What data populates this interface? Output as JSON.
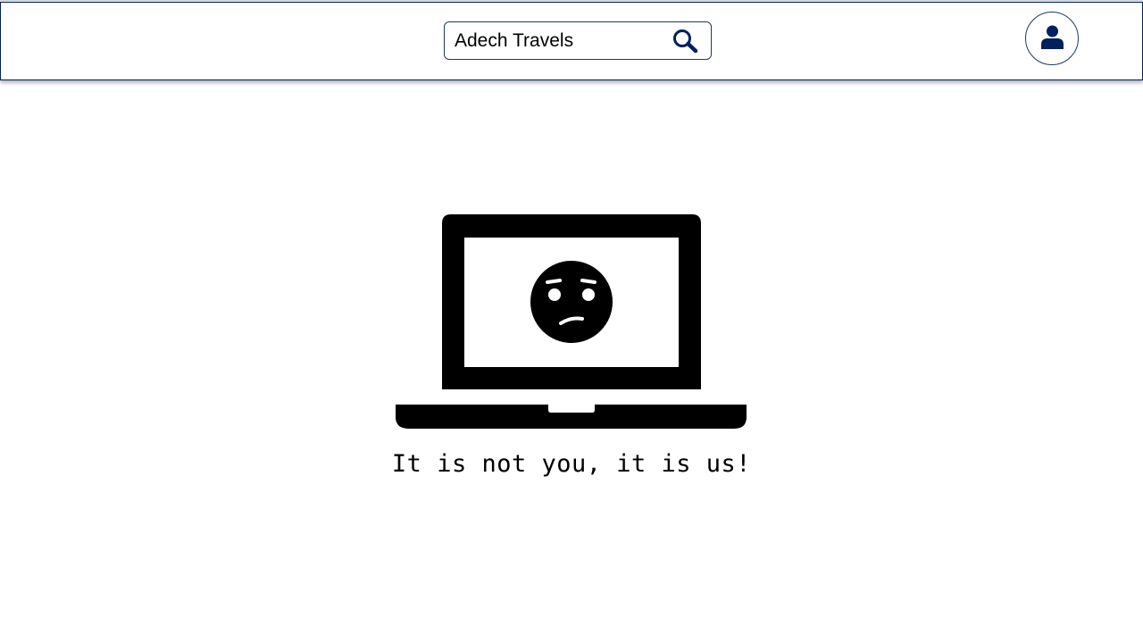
{
  "header": {
    "search": {
      "value": "Adech Travels",
      "icon": "search-icon"
    },
    "account": {
      "icon": "user-icon"
    }
  },
  "error": {
    "illustration_icon": "laptop-sad-face-icon",
    "message": "It is not you, it is us!"
  },
  "colors": {
    "accent": "#002060",
    "border": "#1f3864",
    "illustration": "#000000"
  }
}
